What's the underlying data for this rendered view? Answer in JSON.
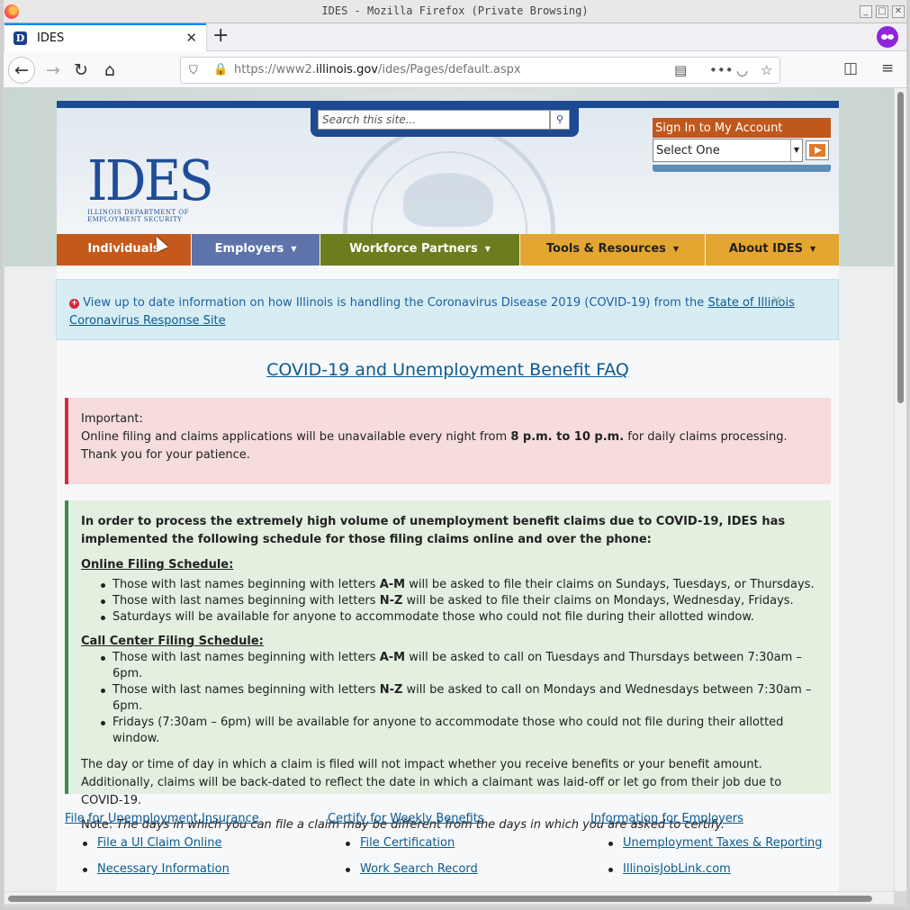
{
  "window": {
    "title": "IDES - Mozilla Firefox (Private Browsing)"
  },
  "tab": {
    "title": "IDES"
  },
  "toolbar": {
    "url_prefix": "https://www2.",
    "url_domain": "illinois.gov",
    "url_path": "/ides/Pages/default.aspx"
  },
  "header": {
    "search_placeholder": "Search this site...",
    "logo_text": "IDES",
    "logo_sub_line1": "ILLINOIS DEPARTMENT OF",
    "logo_sub_line2": "EMPLOYMENT SECURITY",
    "signin_title": "Sign In to My Account",
    "signin_select": "Select One"
  },
  "nav": {
    "items": [
      {
        "label": "Individuals",
        "color": "#c4591b"
      },
      {
        "label": "Employers",
        "color": "#5d73aa"
      },
      {
        "label": "Workforce Partners",
        "color": "#6b7d1f"
      },
      {
        "label": "Tools & Resources",
        "color": "#e3a631"
      },
      {
        "label": "About IDES",
        "color": "#e3a631"
      }
    ]
  },
  "alert": {
    "text": "View up to date information on how Illinois is handling the Coronavirus Disease 2019 (COVID-19) from the ",
    "link": "State of Illinois Coronavirus Response Site",
    "close": "×"
  },
  "faq_title": "COVID-19 and Unemployment Benefit FAQ",
  "important": {
    "label": "Important:",
    "text_before": "Online filing and claims applications will be unavailable every night from ",
    "text_bold": "8 p.m. to 10 p.m.",
    "text_after": " for daily claims processing. Thank you for your patience."
  },
  "schedule": {
    "intro": "In order to process the extremely high volume of unemployment benefit claims due to COVID-19, IDES has implemented the following schedule for those filing claims online and over the phone:",
    "online_heading": "Online Filing Schedule:",
    "online_items": [
      {
        "pre": "Those with last names beginning with letters ",
        "bold": "A-M",
        "post": " will be asked to file their claims on Sundays, Tuesdays, or Thursdays."
      },
      {
        "pre": "Those with last names beginning with letters ",
        "bold": "N-Z",
        "post": " will be asked to file their claims on Mondays, Wednesday, Fridays."
      },
      {
        "pre": "Saturdays will be available for anyone to accommodate those who could not file during their allotted window.",
        "bold": "",
        "post": ""
      }
    ],
    "call_heading": "Call Center Filing Schedule:",
    "call_items": [
      {
        "pre": "Those with last names beginning with letters ",
        "bold": "A-M",
        "post": " will be asked to call on Tuesdays and Thursdays between 7:30am – 6pm."
      },
      {
        "pre": "Those with last names beginning with letters ",
        "bold": "N-Z",
        "post": " will be asked to call on Mondays and Wednesdays between 7:30am – 6pm."
      },
      {
        "pre": "Fridays (7:30am – 6pm) will be available for anyone to accommodate those who could not file during their allotted window.",
        "bold": "",
        "post": ""
      }
    ],
    "body": "The day or time of day in which a claim is filed will not impact whether you receive benefits or your benefit amount. Additionally, claims will be back-dated to reflect the date in which a claimant was laid-off or let go from their job due to COVID-19.",
    "note_label": "Note: ",
    "note_text": "The days in which you can file a claim may be different from the days in which you are asked to certify."
  },
  "links": {
    "col1": {
      "head": "File for Unemployment Insurance",
      "items": [
        "File a UI Claim Online",
        "Necessary Information"
      ]
    },
    "col2": {
      "head": "Certify for Weekly Benefits",
      "items": [
        "File Certification",
        "Work Search Record"
      ]
    },
    "col3": {
      "head": "Information for Employers",
      "items": [
        "Unemployment Taxes & Reporting",
        "IllinoisJobLink.com"
      ]
    }
  }
}
